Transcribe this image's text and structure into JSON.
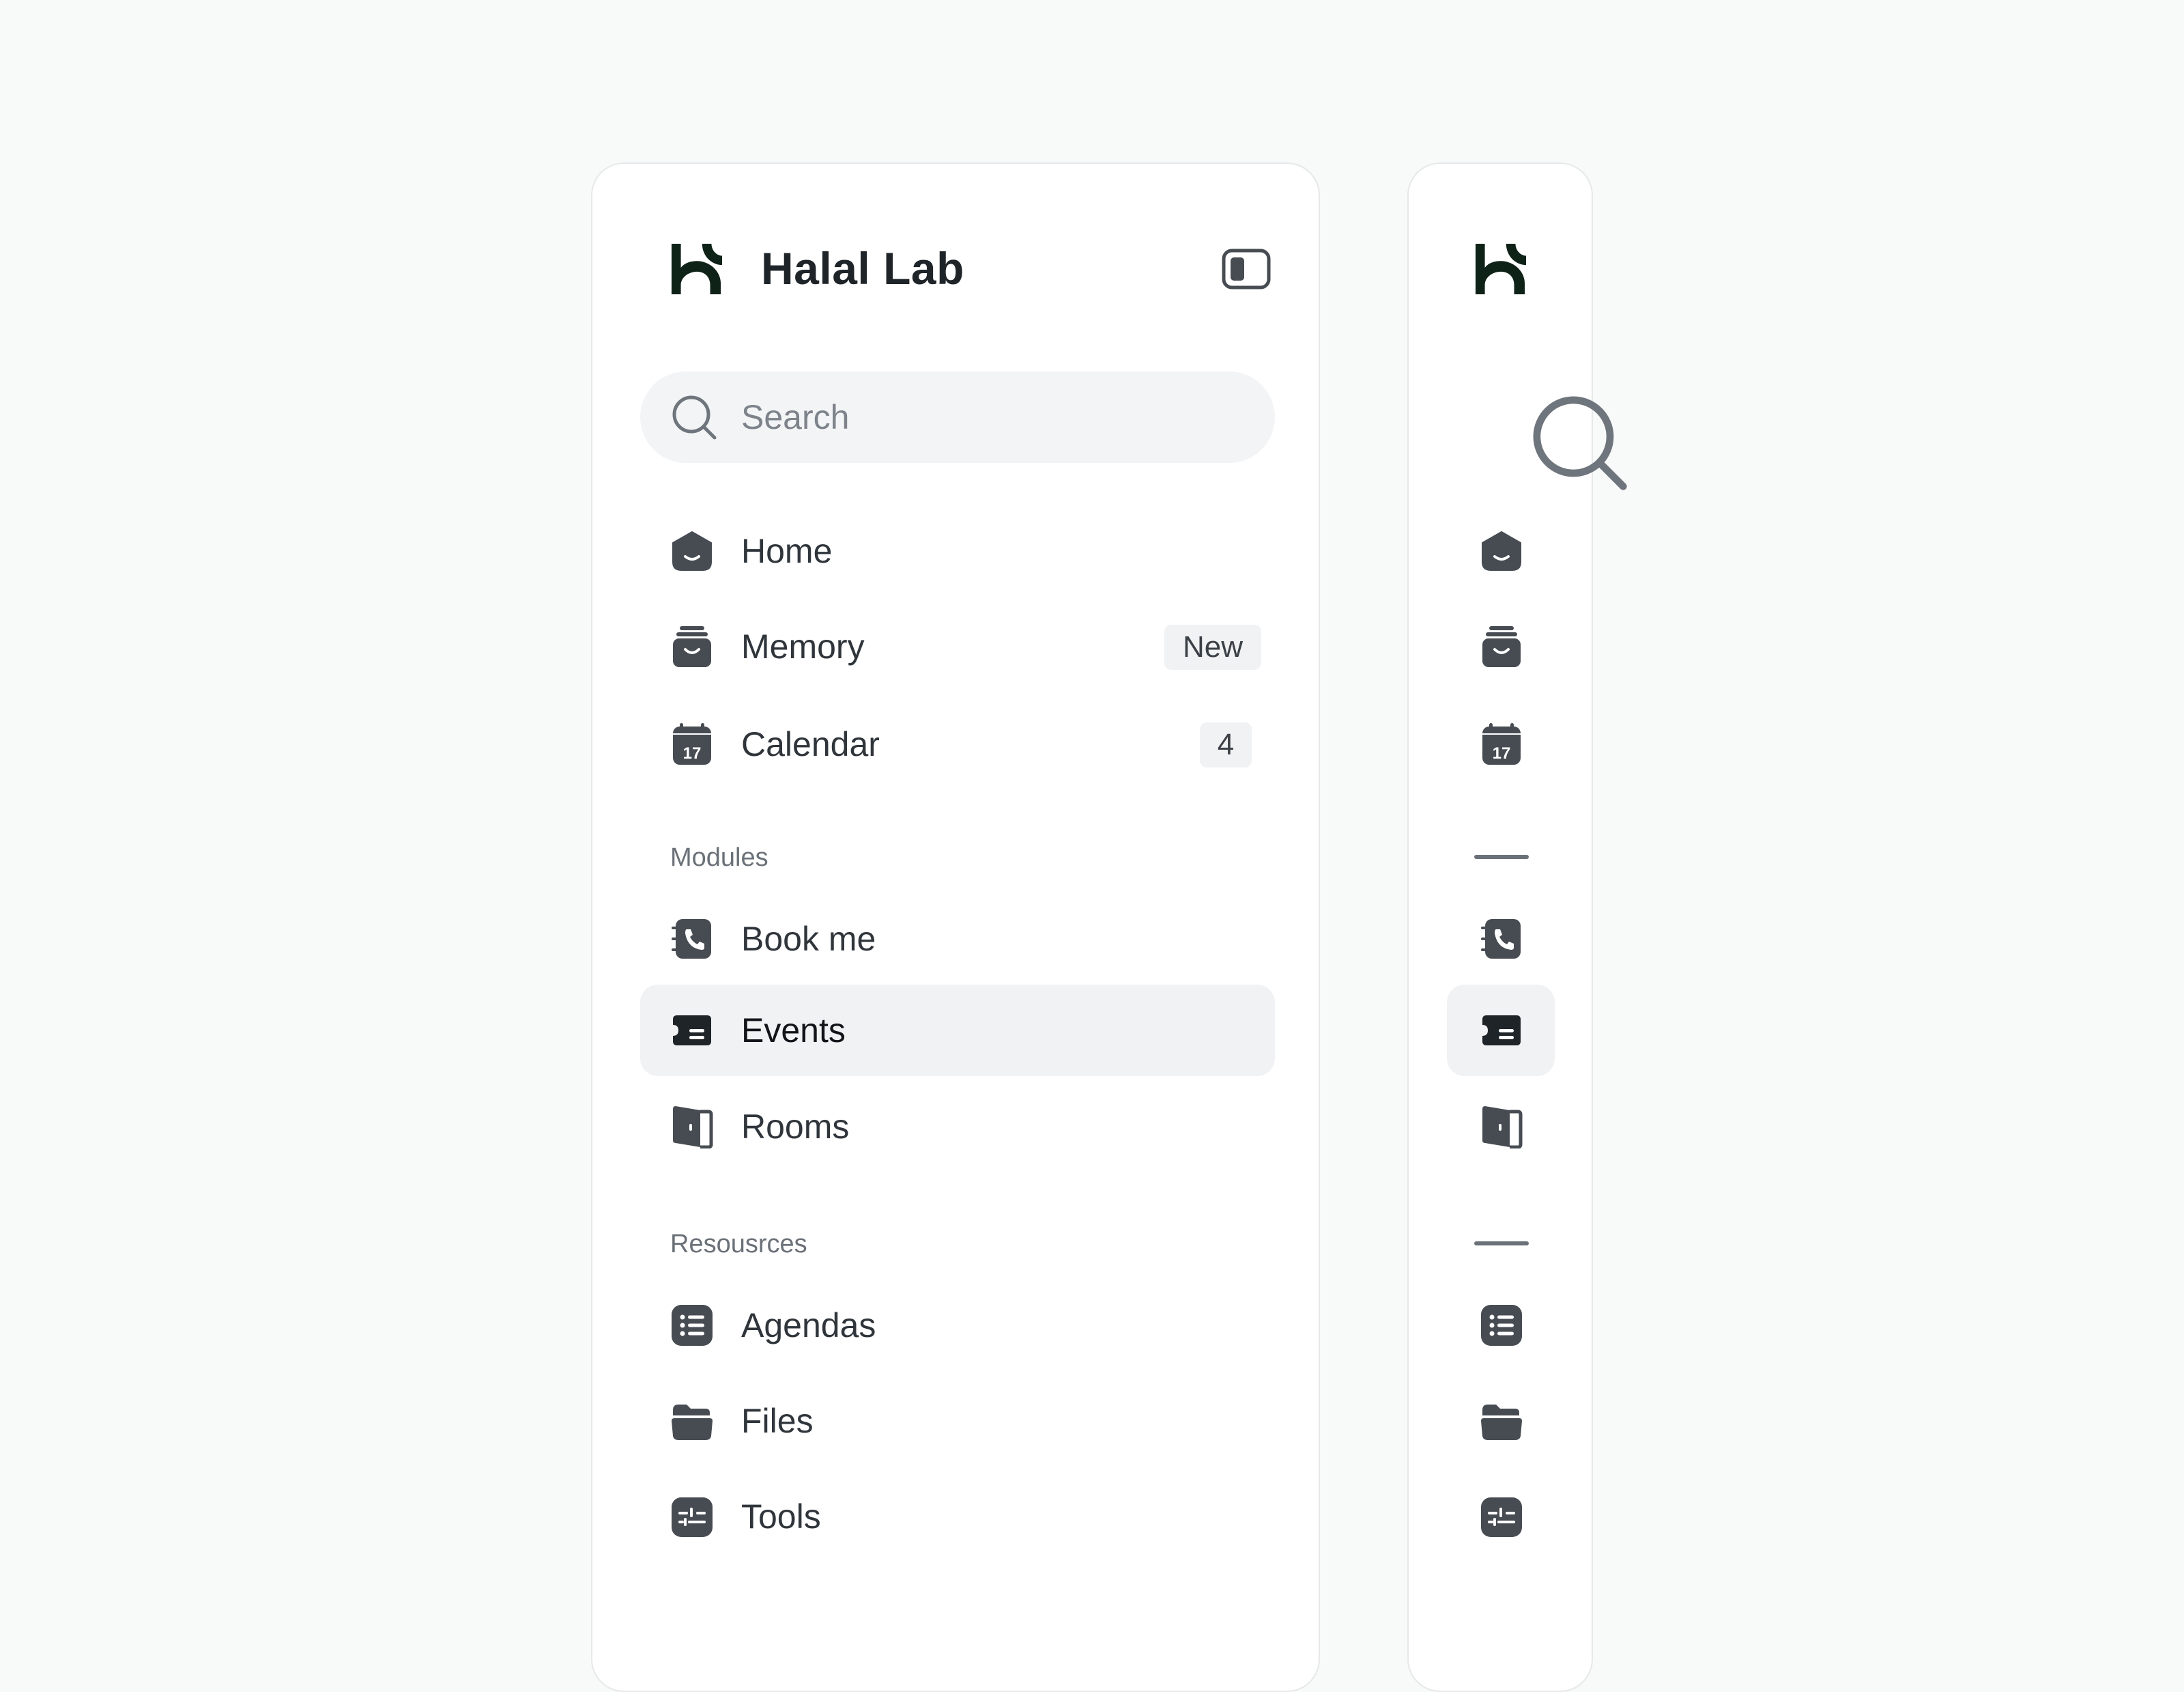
{
  "app": {
    "title": "Halal Lab"
  },
  "colors": {
    "icon": "#474c53",
    "text": "#2f353b",
    "active_bg": "#f1f2f4",
    "logo": "#0f2218"
  },
  "icons": {
    "logo": "halal-lab-logo-icon",
    "toggle": "sidebar-toggle-icon",
    "search": "search-icon"
  },
  "search": {
    "placeholder": "Search"
  },
  "nav": {
    "main": [
      {
        "label": "Home",
        "icon": "home-icon"
      },
      {
        "label": "Memory",
        "icon": "archive-box-icon",
        "badge": "New"
      },
      {
        "label": "Calendar",
        "icon": "calendar-icon",
        "badge": "4"
      }
    ],
    "modules": {
      "title": "Modules",
      "items": [
        {
          "label": "Book me",
          "icon": "contact-book-phone-icon"
        },
        {
          "label": "Events",
          "icon": "ticket-icon",
          "active": true
        },
        {
          "label": "Rooms",
          "icon": "door-icon"
        }
      ]
    },
    "resources": {
      "title": "Resousrces",
      "items": [
        {
          "label": "Agendas",
          "icon": "list-icon"
        },
        {
          "label": "Files",
          "icon": "folder-icon"
        },
        {
          "label": "Tools",
          "icon": "toolbox-icon"
        }
      ]
    }
  }
}
